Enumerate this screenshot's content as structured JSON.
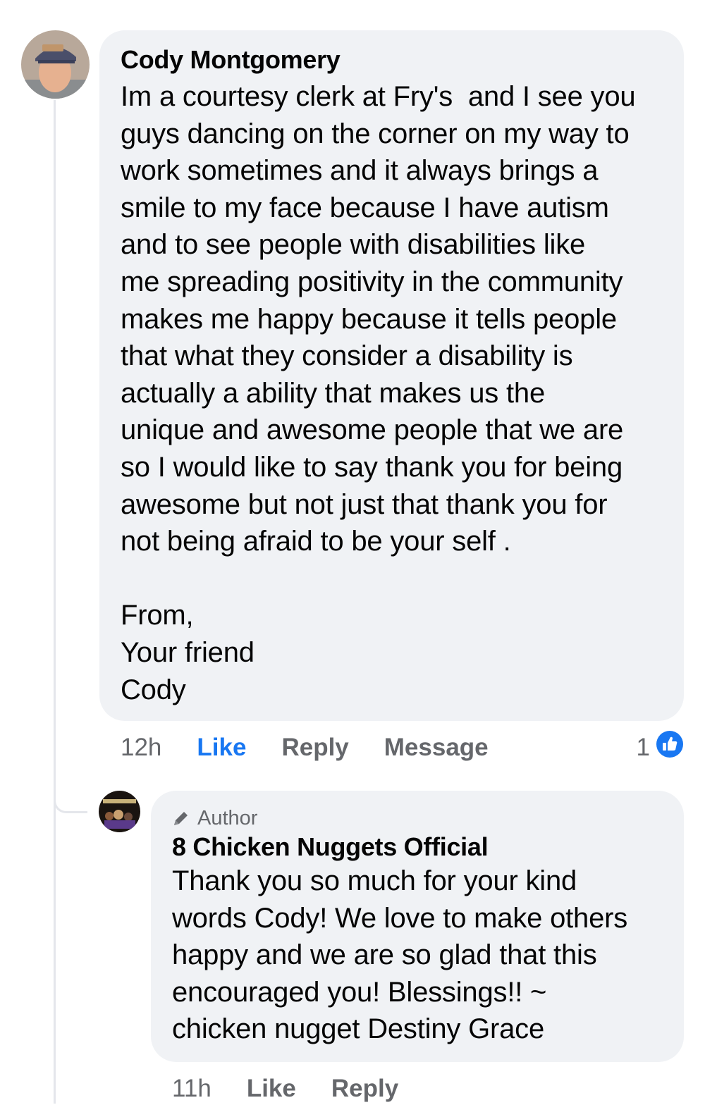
{
  "comment": {
    "author": "Cody Montgomery",
    "text": "Im a courtesy clerk at Fry's  and I see you\nguys dancing on the corner on my way to\nwork sometimes and it always brings a\nsmile to my face because I have autism\nand to see people with disabilities like\nme spreading positivity in the community\nmakes me happy because it tells people\nthat what they consider a disability is\nactually a ability that makes us the\nunique and awesome people that we are\nso I would like to say thank you for being\nawesome but not just that thank you for\nnot being afraid to be your self .\n\nFrom,\nYour friend\nCody",
    "time": "12h",
    "like_label": "Like",
    "reply_label": "Reply",
    "message_label": "Message",
    "reaction_count": "1",
    "reaction_icon": "thumbs-up-icon",
    "accent_color": "#1877f2"
  },
  "reply": {
    "badge": "Author",
    "badge_icon": "pencil-icon",
    "author": "8 Chicken Nuggets Official",
    "text": "Thank you so much for your kind\nwords Cody! We love to make others\nhappy and we are so glad that this\nencouraged you! Blessings!! ~\nchicken nugget Destiny Grace",
    "time": "11h",
    "like_label": "Like",
    "reply_label": "Reply"
  },
  "colors": {
    "bubble": "#f0f2f5",
    "secondary_text": "#65676b",
    "thread_line": "#e4e6eb"
  }
}
